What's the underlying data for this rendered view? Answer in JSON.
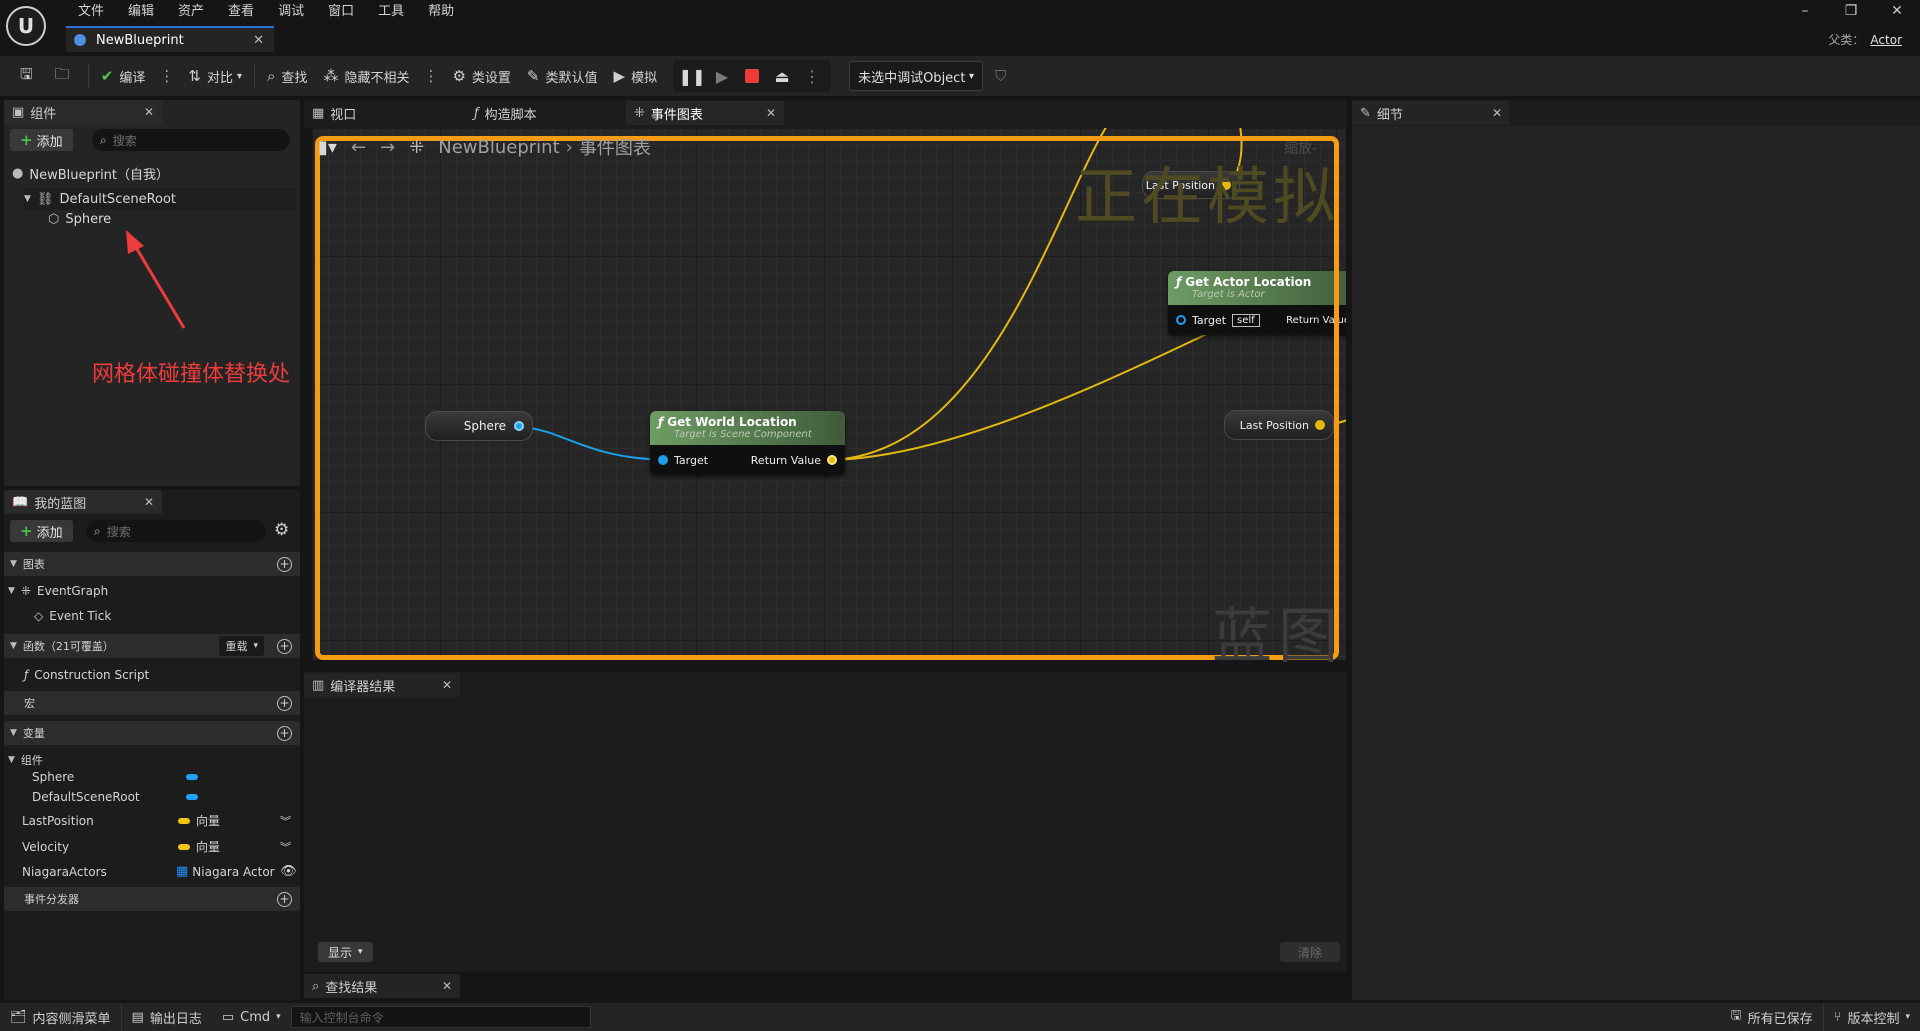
{
  "menu": [
    "文件",
    "编辑",
    "资产",
    "查看",
    "调试",
    "窗口",
    "工具",
    "帮助"
  ],
  "doc_tab": "NewBlueprint",
  "window_buttons": [
    "–",
    "❐",
    "✕"
  ],
  "parent_class": {
    "label": "父类：",
    "value": "Actor"
  },
  "toolbar": {
    "compile": "编译",
    "diff": "对比",
    "find": "查找",
    "hide_unrelated": "隐藏不相关",
    "class_settings": "类设置",
    "class_defaults": "类默认值",
    "simulate": "模拟",
    "debug_object": "未选中调试Object"
  },
  "components_panel": {
    "title": "组件",
    "add": "添加",
    "search_placeholder": "搜索",
    "tree": [
      "NewBlueprint（自我）",
      "DefaultSceneRoot",
      "Sphere"
    ]
  },
  "annotation": "网格体碰撞体替换处",
  "my_blueprint": {
    "title": "我的蓝图",
    "add": "添加",
    "search_placeholder": "搜索",
    "graphs_header": "图表",
    "event_graph": "EventGraph",
    "event_tick": "Event Tick",
    "functions_header": "函数（21可覆盖）",
    "override": "重载",
    "construction_script": "Construction Script",
    "macros_header": "宏",
    "variables_header": "变量",
    "components_group": "组件",
    "variables": [
      {
        "name": "Sphere",
        "type": "",
        "color": "#1fa0ff"
      },
      {
        "name": "DefaultSceneRoot",
        "type": "",
        "color": "#1fa0ff"
      },
      {
        "name": "LastPosition",
        "type": "向量",
        "color": "#f5c518"
      },
      {
        "name": "Velocity",
        "type": "向量",
        "color": "#f5c518"
      },
      {
        "name": "NiagaraActors",
        "type": "Niagara Actor",
        "color": "#1f8cff"
      }
    ],
    "dispatchers_header": "事件分发器"
  },
  "editor_tabs": [
    "视口",
    "构造脚本",
    "事件图表"
  ],
  "graph": {
    "breadcrumb": [
      "NewBlueprint",
      "事件图表"
    ],
    "simulating_overlay": "正在模拟",
    "zoom": "缩放-",
    "watermark": "蓝图",
    "nodes": {
      "sphere_var": "Sphere",
      "get_world_location": {
        "title": "Get World Location",
        "subtitle": "Target is Scene Component",
        "pin_in": "Target",
        "pin_out": "Return Value"
      },
      "get_actor_location": {
        "title": "Get Actor Location",
        "subtitle": "Target is Actor",
        "pin_in": "Target",
        "self_value": "self",
        "pin_out": "Return Value"
      },
      "last_position_top": "Last Position",
      "last_position_right": "Last Position"
    }
  },
  "details_panel": {
    "title": "细节"
  },
  "compiler_results": {
    "title": "编译器结果",
    "show": "显示",
    "clear": "清除"
  },
  "find_results": {
    "title": "查找结果"
  },
  "bottom_bar": {
    "content_drawer": "内容侧滑菜单",
    "output_log": "输出日志",
    "cmd": "Cmd",
    "console_placeholder": "输入控制台命令",
    "all_saved": "所有已保存",
    "source_control": "版本控制"
  }
}
